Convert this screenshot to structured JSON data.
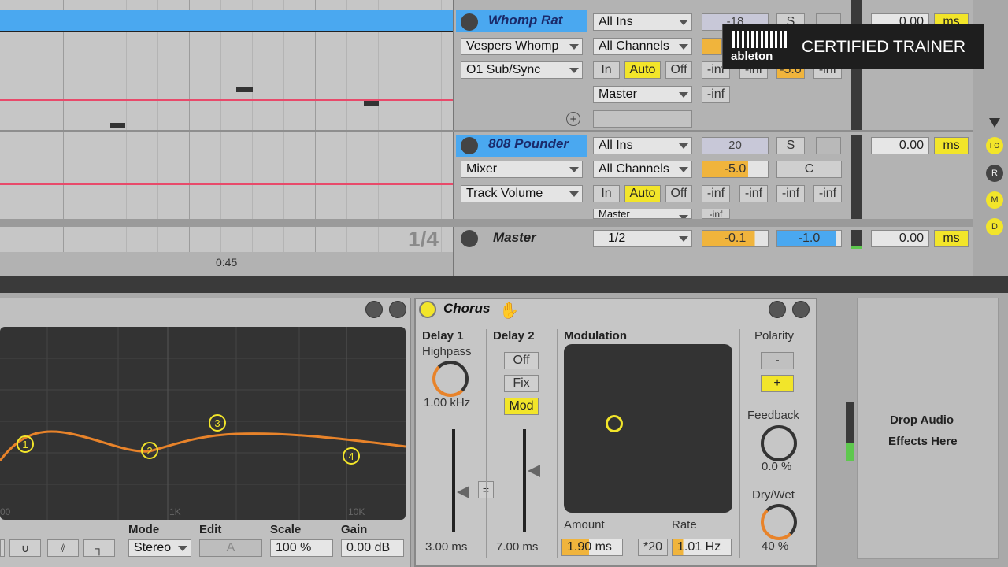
{
  "tracks": [
    {
      "name": "Whomp Rat",
      "input": "All Ins",
      "device": "Vespers Whomp",
      "param": "O1 Sub/Sync",
      "channel": "All Channels",
      "monitor": [
        "In",
        "Auto",
        "Off"
      ],
      "output": "Master",
      "volume": "-18",
      "meters": [
        "-inf",
        "-inf",
        "-5.0",
        "-inf"
      ],
      "send": "-inf",
      "solo": "S",
      "delay": "0.00",
      "unit": "ms"
    },
    {
      "name": "808 Pounder",
      "input": "All Ins",
      "device": "Mixer",
      "param": "Track Volume",
      "channel": "All Channels",
      "monitor": [
        "In",
        "Auto",
        "Off"
      ],
      "output": "Master",
      "volume": "20",
      "vol2": "-5.0",
      "pan": "C",
      "meters": [
        "-inf",
        "-inf",
        "-inf",
        "-inf"
      ],
      "send": "-inf",
      "solo": "S",
      "delay": "0.00",
      "unit": "ms"
    }
  ],
  "master": {
    "name": "Master",
    "quant": "1/2",
    "vol": "-0.1",
    "pan": "-1.0",
    "delay": "0.00",
    "unit": "ms",
    "page": "1/4"
  },
  "timeline": {
    "marker": "0:45"
  },
  "side_buttons": [
    "I·O",
    "R",
    "M",
    "D"
  ],
  "badge": {
    "brand": "ableton",
    "text": "CERTIFIED TRAINER"
  },
  "eq": {
    "mode_label": "Mode",
    "mode": "Stereo",
    "edit_label": "Edit",
    "edit": "A",
    "scale_label": "Scale",
    "scale": "100 %",
    "gain_label": "Gain",
    "gain": "0.00 dB",
    "freq_labels": [
      "00",
      "1K",
      "10K"
    ],
    "points": [
      "1",
      "2",
      "3",
      "4"
    ]
  },
  "chorus": {
    "title": "Chorus",
    "delay1_label": "Delay 1",
    "highpass_label": "Highpass",
    "highpass": "1.00 kHz",
    "delay1_value": "3.00 ms",
    "delay2_label": "Delay 2",
    "d2_off": "Off",
    "d2_fix": "Fix",
    "d2_mod": "Mod",
    "delay2_value": "7.00 ms",
    "link": "=",
    "mod_label": "Modulation",
    "amount_label": "Amount",
    "amount": "1.90 ms",
    "rate_label": "Rate",
    "rate_mult": "*20",
    "rate": "1.01 Hz",
    "polarity_label": "Polarity",
    "pol_minus": "-",
    "pol_plus": "+",
    "feedback_label": "Feedback",
    "feedback": "0.0 %",
    "drywet_label": "Dry/Wet",
    "drywet": "40 %"
  },
  "drop": {
    "line1": "Drop Audio",
    "line2": "Effects Here"
  }
}
